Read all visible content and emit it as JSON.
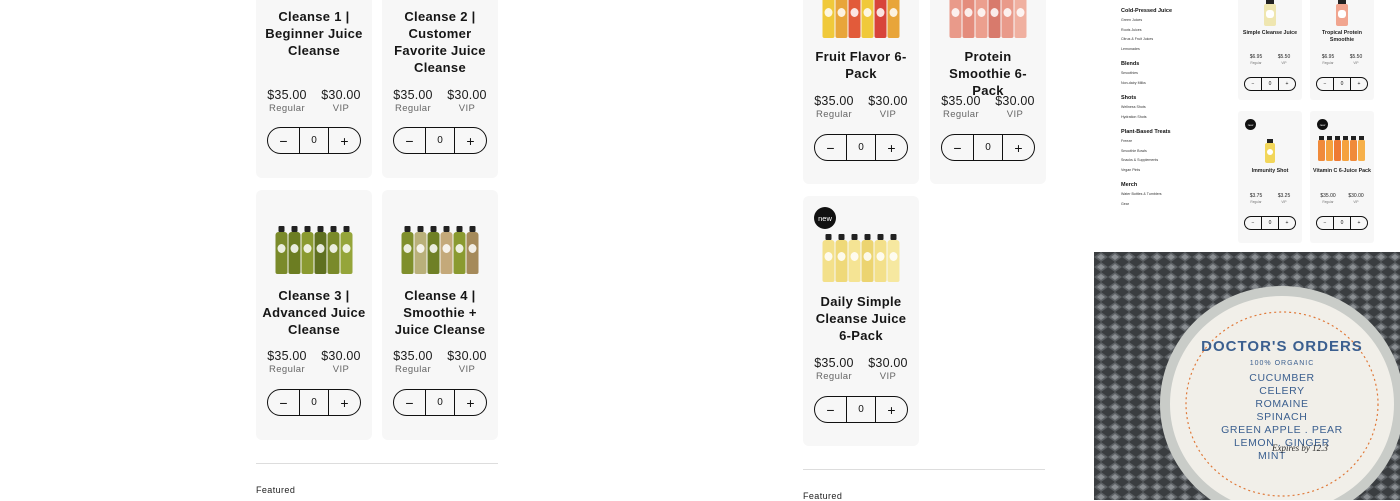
{
  "left_grid": {
    "products": [
      {
        "title": "Cleanse 1 | Beginner Juice Cleanse",
        "regular_price": "$35.00",
        "regular_label": "Regular",
        "vip_price": "$30.00",
        "vip_label": "VIP",
        "qty": "0",
        "icon": "juice-bottles-image",
        "bottle_colors": []
      },
      {
        "title": "Cleanse 2 | Customer Favorite Juice Cleanse",
        "regular_price": "$35.00",
        "regular_label": "Regular",
        "vip_price": "$30.00",
        "vip_label": "VIP",
        "qty": "0",
        "icon": "juice-bottles-image",
        "bottle_colors": []
      },
      {
        "title": "Cleanse 3 | Advanced Juice Cleanse",
        "regular_price": "$35.00",
        "regular_label": "Regular",
        "vip_price": "$30.00",
        "vip_label": "VIP",
        "qty": "0",
        "icon": "juice-bottles-image",
        "bottle_colors": [
          "#7a8a2a",
          "#6c7d22",
          "#8a9a30",
          "#5f7020",
          "#7a8a2a",
          "#95a53a"
        ]
      },
      {
        "title": "Cleanse 4 | Smoothie + Juice Cleanse",
        "regular_price": "$35.00",
        "regular_label": "Regular",
        "vip_price": "$30.00",
        "vip_label": "VIP",
        "qty": "0",
        "icon": "juice-bottles-image",
        "bottle_colors": [
          "#7f8f2c",
          "#b9b07a",
          "#6f8026",
          "#c4a97a",
          "#8a9a30",
          "#a58a5a"
        ]
      }
    ],
    "featured_label": "Featured"
  },
  "middle_grid": {
    "products": [
      {
        "title": "Fruit Flavor 6-Pack",
        "regular_price": "$35.00",
        "regular_label": "Regular",
        "vip_price": "$30.00",
        "vip_label": "VIP",
        "qty": "0",
        "badge": "",
        "bottle_colors": [
          "#f0c93a",
          "#e8a53a",
          "#e25b3a",
          "#f0c93a",
          "#d8443a",
          "#e8a53a"
        ]
      },
      {
        "title": "Protein Smoothie 6-Pack",
        "regular_price": "$35.00",
        "regular_label": "Regular",
        "vip_price": "$30.00",
        "vip_label": "VIP",
        "qty": "0",
        "badge": "",
        "bottle_colors": [
          "#e99a8a",
          "#e48c7c",
          "#ec9f8e",
          "#d87a6c",
          "#e99a8a",
          "#f0b0a0"
        ]
      },
      {
        "title": "Daily Simple Cleanse Juice 6-Pack",
        "regular_price": "$35.00",
        "regular_label": "Regular",
        "vip_price": "$30.00",
        "vip_label": "VIP",
        "qty": "0",
        "badge": "new",
        "bottle_colors": [
          "#f3e08a",
          "#efd979",
          "#f5e494",
          "#ecd470",
          "#f3e08a",
          "#f6e8a0"
        ]
      }
    ],
    "featured_label": "Featured"
  },
  "mini_screenshot": {
    "nav": [
      {
        "heading": "Cold-Pressed Juice",
        "items": [
          "Green Juices",
          "Roots Juices",
          "Citrus & Fruit Juices",
          "Lemonades"
        ]
      },
      {
        "heading": "Blends",
        "items": [
          "Smoothies",
          "Non-dairy Milks"
        ]
      },
      {
        "heading": "Shots",
        "items": [
          "Wellness Shots",
          "Hydration Shots"
        ]
      },
      {
        "heading": "Plant-Based Treats",
        "items": [
          "Freeze",
          "Smoothie Bowls",
          "Snacks & Supplements",
          "Vegan Pints"
        ]
      },
      {
        "heading": "Merch",
        "items": [
          "Water Bottles & Tumblers",
          "Gear"
        ]
      }
    ],
    "products": [
      {
        "title": "Simple Cleanse Juice",
        "regular_price": "$6.95",
        "regular_label": "Regular",
        "vip_price": "$5.50",
        "vip_label": "VIP",
        "qty": "0",
        "badge": ""
      },
      {
        "title": "Tropical Protein Smoothie",
        "regular_price": "$6.95",
        "regular_label": "Regular",
        "vip_price": "$5.50",
        "vip_label": "VIP",
        "qty": "0",
        "badge": ""
      },
      {
        "title": "Immunity Shot",
        "regular_price": "$3.75",
        "regular_label": "Regular",
        "vip_price": "$3.25",
        "vip_label": "VIP",
        "qty": "0",
        "badge": "new"
      },
      {
        "title": "Vitamin C 6-Juice Pack",
        "regular_price": "$35.00",
        "regular_label": "Regular",
        "vip_price": "$30.00",
        "vip_label": "VIP",
        "qty": "0",
        "badge": "new"
      }
    ]
  },
  "photo": {
    "label_brand": "DOCTOR'S ORDERS",
    "label_subtitle": "100% ORGANIC",
    "ingredients": [
      "CUCUMBER",
      "CELERY",
      "ROMAINE",
      "SPINACH",
      "GREEN APPLE . PEAR",
      "LEMON . GINGER",
      "MINT"
    ],
    "handwritten": "Expires by 12.3"
  },
  "colors": {
    "card_bg": "#f7f7f7",
    "text": "#111111",
    "label_cream": "#f2f0ea",
    "label_blue": "#3b5f8f",
    "label_orange": "#e07a3a"
  }
}
